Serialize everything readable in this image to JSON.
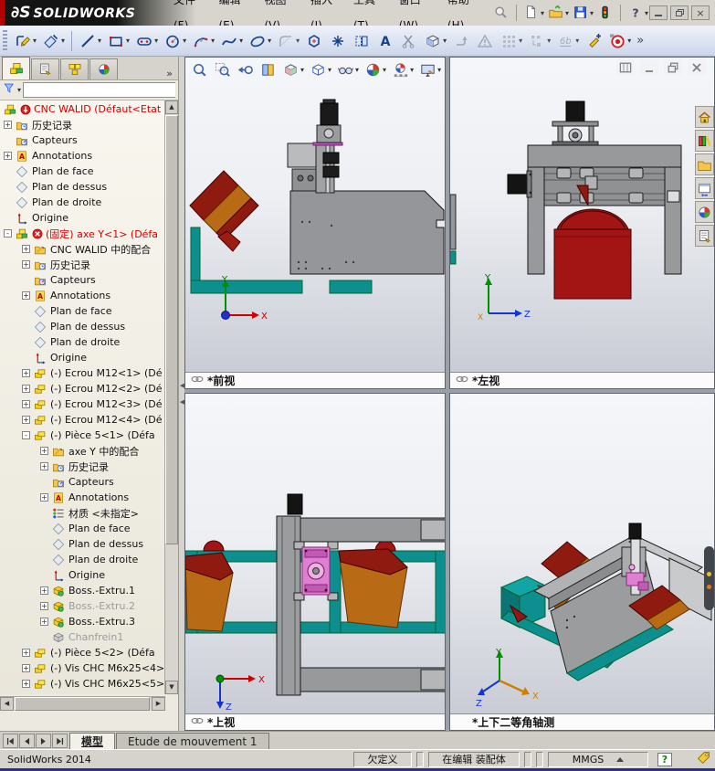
{
  "titlebar": {
    "logo_mark": "∂S",
    "logo_text": "SOLIDWORKS",
    "menus": [
      "文件(F)",
      "编辑(E)",
      "视图(V)",
      "插入(I)",
      "工具(T)",
      "窗口(W)",
      "帮助(H)"
    ]
  },
  "sketch_toolbar": {
    "items": [
      {
        "name": "sketch",
        "icon": "tb_sketch",
        "dd": true
      },
      {
        "name": "smart-dimension",
        "icon": "tb_dim",
        "dd": true
      },
      {
        "sep": true
      },
      {
        "name": "line",
        "icon": "tb_line",
        "dd": true
      },
      {
        "name": "corner-rectangle",
        "icon": "tb_rect",
        "dd": true
      },
      {
        "name": "straight-slot",
        "icon": "tb_slot",
        "dd": true
      },
      {
        "name": "circle",
        "icon": "tb_circle",
        "dd": true
      },
      {
        "name": "centerpoint-arc",
        "icon": "tb_arc",
        "dd": true
      },
      {
        "name": "spline",
        "icon": "tb_spline",
        "dd": true
      },
      {
        "name": "ellipse",
        "icon": "tb_ellipse",
        "dd": true
      },
      {
        "name": "sketch-fillet",
        "icon": "tb_fillet",
        "dd": true,
        "disabled": true
      },
      {
        "name": "polygon",
        "icon": "tb_polygon"
      },
      {
        "name": "point",
        "icon": "tb_point"
      },
      {
        "name": "mirror-entities",
        "icon": "tb_mirror"
      },
      {
        "name": "sketch-text",
        "icon": "tb_text"
      },
      {
        "name": "trim-entities",
        "icon": "tb_trim",
        "disabled": true
      },
      {
        "name": "extruded-boss",
        "icon": "tb_cube",
        "dd": true
      },
      {
        "name": "convert-entities",
        "icon": "tb_convert",
        "disabled": true
      },
      {
        "name": "error-check",
        "icon": "tb_warn",
        "disabled": true
      },
      {
        "name": "linear-pattern",
        "icon": "tb_pattern",
        "dd": true,
        "disabled": true
      },
      {
        "name": "offset-entities",
        "icon": "tb_offset",
        "dd": true,
        "disabled": true
      },
      {
        "name": "display-relations",
        "icon": "tb_relations",
        "dd": true,
        "disabled": true
      },
      {
        "name": "annotation-pen",
        "icon": "tb_penplus"
      },
      {
        "name": "record-macro",
        "icon": "tb_reddot",
        "dd": true
      },
      {
        "name": "toolbar-overflow",
        "text": "»"
      }
    ]
  },
  "hud_toolbar": {
    "items": [
      {
        "name": "zoom-to-fit",
        "icon": "hud_zoomfit"
      },
      {
        "name": "zoom-to-area",
        "icon": "hud_zoomarea"
      },
      {
        "name": "previous-view",
        "icon": "hud_prev"
      },
      {
        "name": "section-view",
        "icon": "hud_section"
      },
      {
        "name": "view-orientation",
        "icon": "hud_orient",
        "dd": true
      },
      {
        "name": "display-style",
        "icon": "hud_display",
        "dd": true
      },
      {
        "name": "hide-show-items",
        "icon": "hud_glasses",
        "dd": true
      },
      {
        "name": "edit-appearance",
        "icon": "hud_ball",
        "dd": true
      },
      {
        "name": "apply-scene",
        "icon": "hud_scene",
        "dd": true
      },
      {
        "name": "view-settings",
        "icon": "hud_monitor",
        "dd": true
      }
    ]
  },
  "panel_tabs": {
    "tabs": [
      {
        "name": "featuremanager-tree-tab",
        "icon": "pt_tree",
        "active": true
      },
      {
        "name": "propertymanager-tab",
        "icon": "pt_prop"
      },
      {
        "name": "configurationmanager-tab",
        "icon": "pt_config"
      },
      {
        "name": "displaymanager-tab",
        "icon": "pt_display"
      }
    ],
    "overflow": "»"
  },
  "feature_tree": {
    "items": [
      {
        "level": 0,
        "icon": "assembly",
        "badge": "badge_rebuild",
        "label": "CNC WALID  (Défaut<Etat",
        "red": true
      },
      {
        "level": 1,
        "expand": "+",
        "icon": "history",
        "label": "历史记录"
      },
      {
        "level": 1,
        "icon": "sensors",
        "label": "Capteurs"
      },
      {
        "level": 1,
        "expand": "+",
        "icon": "annotations",
        "label": "Annotations"
      },
      {
        "level": 1,
        "icon": "plane",
        "label": "Plan de face"
      },
      {
        "level": 1,
        "icon": "plane",
        "label": "Plan de dessus"
      },
      {
        "level": 1,
        "icon": "plane",
        "label": "Plan de droite"
      },
      {
        "level": 1,
        "icon": "origin",
        "label": "Origine"
      },
      {
        "level": 1,
        "expand": "-",
        "icon": "assembly",
        "badge": "badge_error",
        "label": "(固定) axe Y<1> (Défa",
        "red": true
      },
      {
        "level": 2,
        "expand": "+",
        "icon": "mates",
        "label": "CNC WALID 中的配合"
      },
      {
        "level": 2,
        "expand": "+",
        "icon": "history",
        "label": "历史记录"
      },
      {
        "level": 2,
        "icon": "sensors",
        "label": "Capteurs"
      },
      {
        "level": 2,
        "expand": "+",
        "icon": "annotations",
        "label": "Annotations"
      },
      {
        "level": 2,
        "icon": "plane",
        "label": "Plan de face"
      },
      {
        "level": 2,
        "icon": "plane",
        "label": "Plan de dessus"
      },
      {
        "level": 2,
        "icon": "plane",
        "label": "Plan de droite"
      },
      {
        "level": 2,
        "icon": "origin",
        "label": "Origine"
      },
      {
        "level": 2,
        "expand": "+",
        "icon": "part",
        "label": "(-) Ecrou M12<1> (Dé"
      },
      {
        "level": 2,
        "expand": "+",
        "icon": "part",
        "label": "(-) Ecrou M12<2> (Dé"
      },
      {
        "level": 2,
        "expand": "+",
        "icon": "part",
        "label": "(-) Ecrou M12<3> (Dé"
      },
      {
        "level": 2,
        "expand": "+",
        "icon": "part",
        "label": "(-) Ecrou M12<4> (Dé"
      },
      {
        "level": 2,
        "expand": "-",
        "icon": "part",
        "label": "(-) Pièce 5<1> (Défa"
      },
      {
        "level": 3,
        "expand": "+",
        "icon": "mates",
        "label": "axe Y 中的配合"
      },
      {
        "level": 3,
        "expand": "+",
        "icon": "history",
        "label": "历史记录"
      },
      {
        "level": 3,
        "icon": "sensors",
        "label": "Capteurs"
      },
      {
        "level": 3,
        "expand": "+",
        "icon": "annotations",
        "label": "Annotations"
      },
      {
        "level": 3,
        "icon": "material",
        "label": "材质 <未指定>"
      },
      {
        "level": 3,
        "icon": "plane",
        "label": "Plan de face"
      },
      {
        "level": 3,
        "icon": "plane",
        "label": "Plan de dessus"
      },
      {
        "level": 3,
        "icon": "plane",
        "label": "Plan de droite"
      },
      {
        "level": 3,
        "icon": "origin",
        "label": "Origine"
      },
      {
        "level": 3,
        "expand": "+",
        "icon": "extrude",
        "label": "Boss.-Extru.1"
      },
      {
        "level": 3,
        "expand": "+",
        "icon": "extrude",
        "label": "Boss.-Extru.2",
        "dim": true
      },
      {
        "level": 3,
        "expand": "+",
        "icon": "extrude",
        "label": "Boss.-Extru.3"
      },
      {
        "level": 3,
        "icon": "chamfer",
        "label": "Chanfrein1",
        "dim": true
      },
      {
        "level": 2,
        "expand": "+",
        "icon": "part",
        "label": "(-) Pièce 5<2> (Défa"
      },
      {
        "level": 2,
        "expand": "+",
        "icon": "part",
        "label": "(-) Vis CHC M6x25<4>"
      },
      {
        "level": 2,
        "expand": "+",
        "icon": "part",
        "label": "(-) Vis CHC M6x25<5>"
      }
    ]
  },
  "viewports": [
    {
      "name": "front",
      "label": "*前视",
      "linked": true,
      "triad": {
        "up": "Y",
        "right": "X"
      }
    },
    {
      "name": "left",
      "label": "*左视",
      "linked": true,
      "triad": {
        "up": "Y",
        "right": "Z",
        "origin": "X"
      }
    },
    {
      "name": "top",
      "label": "*上视",
      "linked": true,
      "triad": {
        "right": "X",
        "down": "Z"
      }
    },
    {
      "name": "isometric",
      "label": "*上下二等角轴测",
      "linked": false,
      "triad": {
        "up": "Y",
        "right": "X",
        "left": "Z"
      }
    }
  ],
  "taskpane": {
    "items": [
      {
        "name": "solidworks-resources",
        "icon": "tp_home"
      },
      {
        "name": "design-library",
        "icon": "tp_dlib"
      },
      {
        "name": "file-explorer",
        "icon": "tp_folder"
      },
      {
        "name": "view-palette",
        "icon": "tp_palette"
      },
      {
        "name": "appearances-scenes",
        "icon": "tp_ball"
      },
      {
        "name": "custom-properties",
        "icon": "tp_props"
      }
    ]
  },
  "doc_tabs": {
    "tabs": [
      {
        "label": "模型",
        "active": true
      },
      {
        "label": "Etude de mouvement 1",
        "active": false
      }
    ]
  },
  "statusbar": {
    "app_version": "SolidWorks 2014",
    "define_state": "欠定义",
    "edit_state": "在编辑 装配体",
    "units": "MMGS",
    "help": "?"
  },
  "colors": {
    "accent_red": "#cc0000",
    "frame_teal": "#0e8f8f",
    "machine_gray": "#94969a",
    "part_dark_red": "#a31414",
    "part_orange": "#b96a15",
    "part_magenta": "#df7fd4",
    "toolbar_navy": "#16418c"
  }
}
